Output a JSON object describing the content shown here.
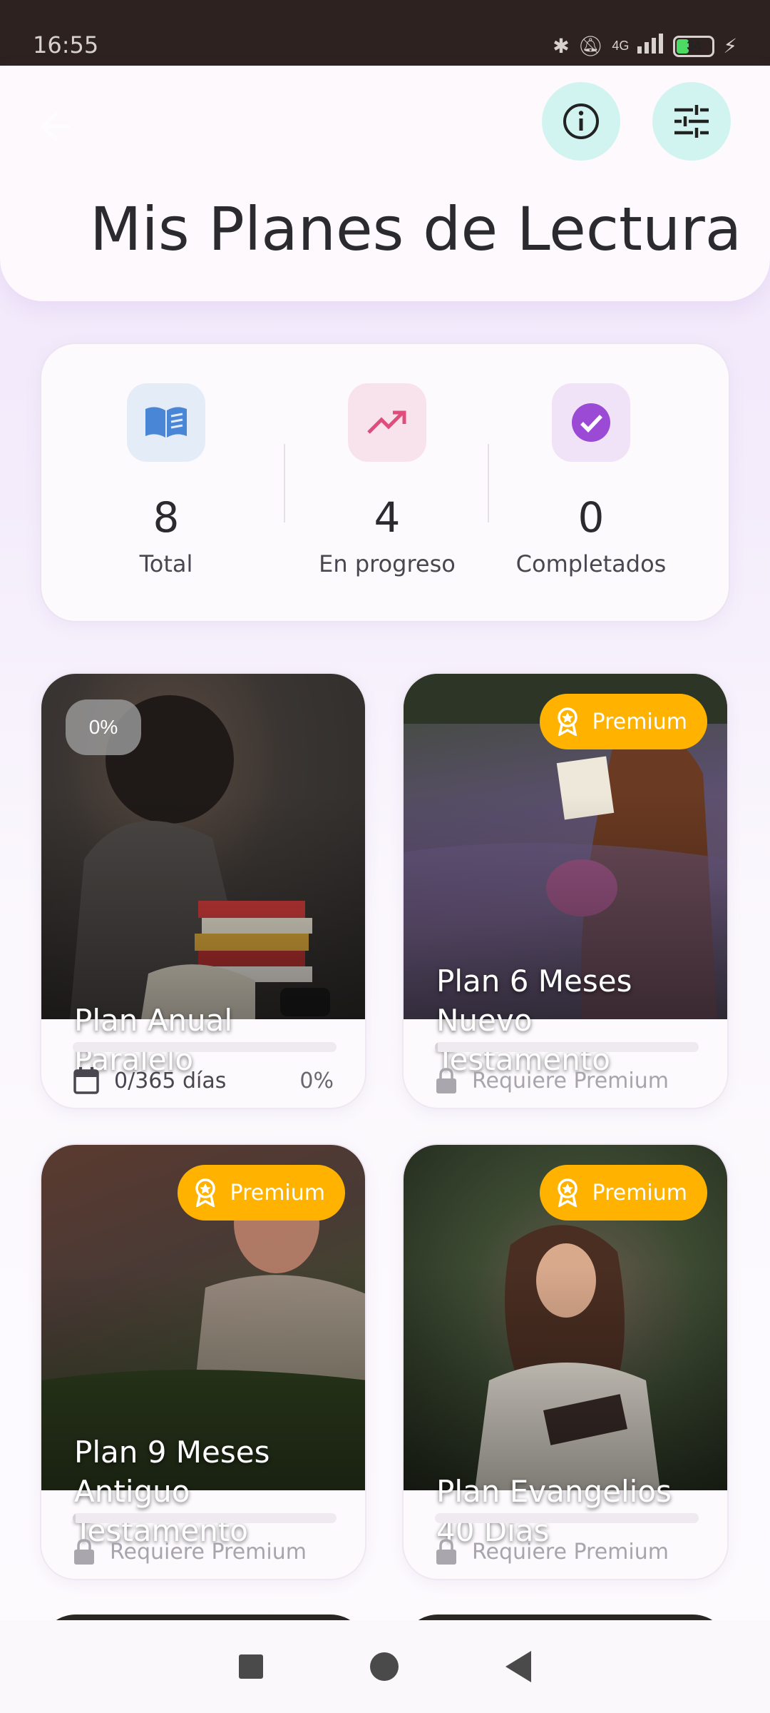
{
  "status_bar": {
    "time": "16:55",
    "network": "4G",
    "battery": "34"
  },
  "header": {
    "title": "Mis Planes de Lectura",
    "info_icon": "info-icon",
    "filter_icon": "tune-icon"
  },
  "stats": [
    {
      "value": "8",
      "label": "Total",
      "icon": "book-icon",
      "color": "#4a86d6",
      "bg": "#e4ecf8"
    },
    {
      "value": "4",
      "label": "En progreso",
      "icon": "trending-up-icon",
      "color": "#e04d7d",
      "bg": "#f8e3ec"
    },
    {
      "value": "0",
      "label": "Completados",
      "icon": "check-circle-icon",
      "color": "#9b4ad6",
      "bg": "#f0e3f8"
    }
  ],
  "plans": [
    {
      "title": "Plan Anual Paralelo",
      "badge": "0%",
      "progress_text": "0/365 días",
      "percent": "0%",
      "progress": 0.0,
      "locked": false
    },
    {
      "title": "Plan 6 Meses Nuevo Testamento",
      "badge": "Premium",
      "lock_text": "Requiere Premium",
      "progress": 0.0,
      "locked": true
    },
    {
      "title": "Plan 9 Meses Antiguo Testamento",
      "badge": "Premium",
      "lock_text": "Requiere Premium",
      "progress": 0.0,
      "locked": true
    },
    {
      "title": "Plan Evangelios 40 Días",
      "badge": "Premium",
      "lock_text": "Requiere Premium",
      "progress": 0.0,
      "locked": true
    }
  ],
  "colors": {
    "premium": "#ffb300",
    "header_button_bg": "#d2f4f1"
  }
}
